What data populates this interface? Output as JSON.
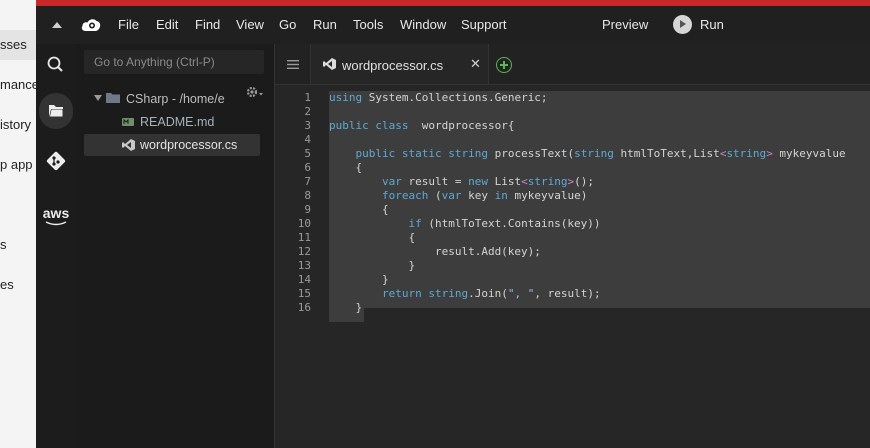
{
  "left_page": {
    "items": [
      "sses",
      "mance",
      "istory",
      "p app",
      "s",
      "es"
    ]
  },
  "menubar": {
    "items": [
      "File",
      "Edit",
      "Find",
      "View",
      "Go",
      "Run",
      "Tools",
      "Window",
      "Support"
    ],
    "preview_label": "Preview",
    "run_label": "Run"
  },
  "rail": {
    "icons": [
      "search-icon",
      "folder-icon",
      "git-icon",
      "aws-icon"
    ],
    "aws_label": "aws"
  },
  "tree": {
    "goto_placeholder": "Go to Anything (Ctrl-P)",
    "root_label": "CSharp - /home/e",
    "files": [
      "README.md",
      "wordprocessor.cs"
    ]
  },
  "editor": {
    "tab_name": "wordprocessor.cs",
    "close_glyph": "✕",
    "line_numbers": [
      "1",
      "2",
      "3",
      "4",
      "5",
      "6",
      "7",
      "8",
      "9",
      "10",
      "11",
      "12",
      "13",
      "14",
      "15",
      "16"
    ]
  },
  "colors": {
    "accent_red": "#c8282a",
    "add_tab_green": "#59b84f",
    "keyword": "#5fa8d3",
    "type": "#c586c0"
  }
}
